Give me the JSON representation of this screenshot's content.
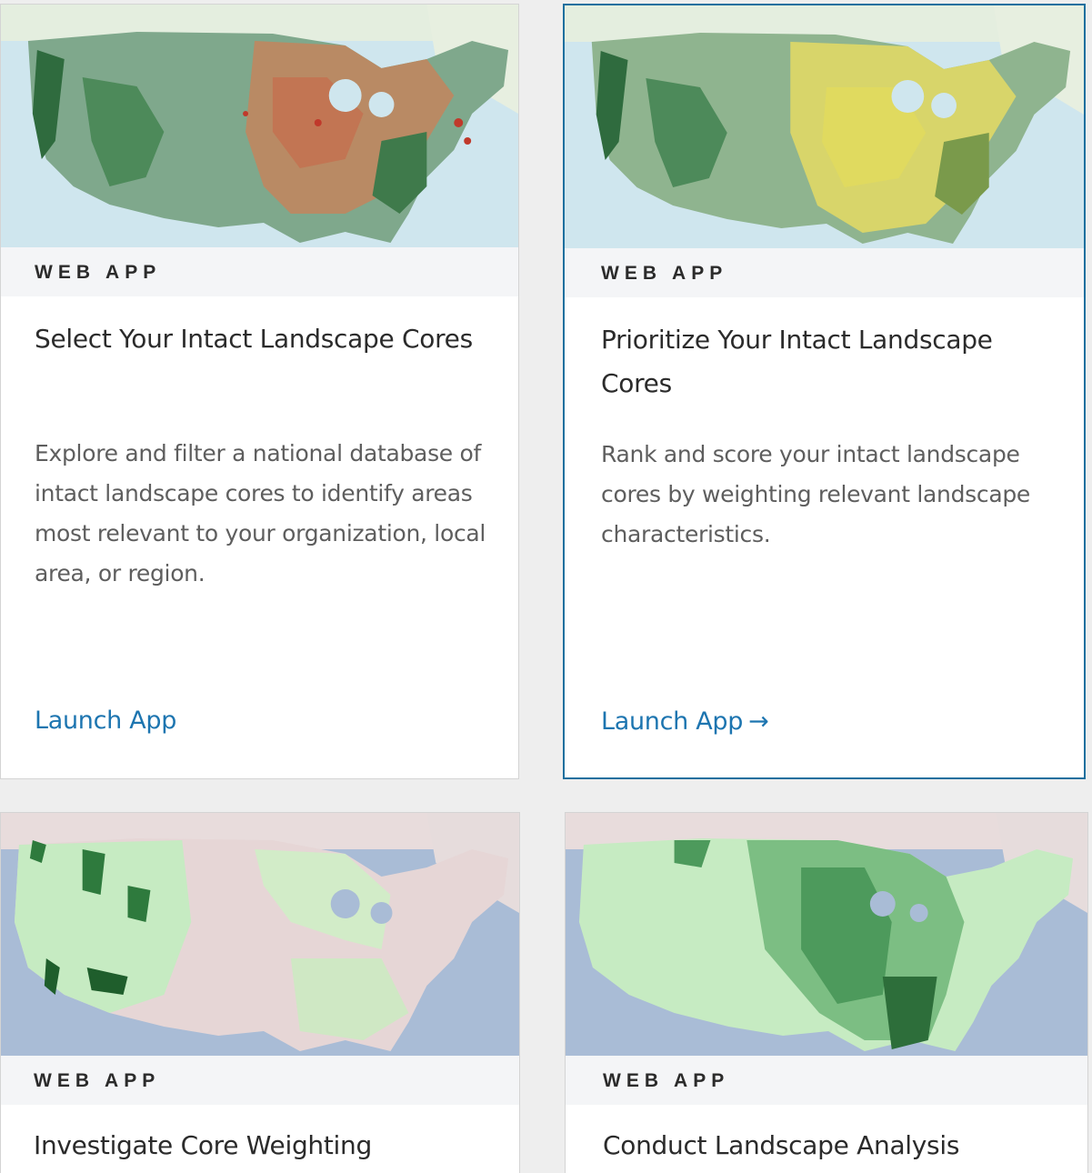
{
  "cards": [
    {
      "type": "WEB APP",
      "title": "Select Your Intact Landscape Cores",
      "description": "Explore and filter a national database of intact landscape cores to identify areas most relevant to your organization, local area, or region.",
      "link": "Launch App",
      "map_palette": "green-red-brown"
    },
    {
      "type": "WEB APP",
      "title": "Prioritize Your Intact Landscape Cores",
      "description": "Rank and score your intact landscape cores by weighting relevant landscape characteristics.",
      "link": "Launch App",
      "link_arrow": "→",
      "map_palette": "green-yellow"
    },
    {
      "type": "WEB APP",
      "title": "Investigate Core Weighting",
      "map_palette": "light-green-on-pink"
    },
    {
      "type": "WEB APP",
      "title": "Conduct Landscape Analysis",
      "map_palette": "green-on-pink"
    }
  ],
  "colors": {
    "link": "#1d75b0",
    "active_border": "#1b6f9e",
    "page_bg": "#eeeeee"
  }
}
